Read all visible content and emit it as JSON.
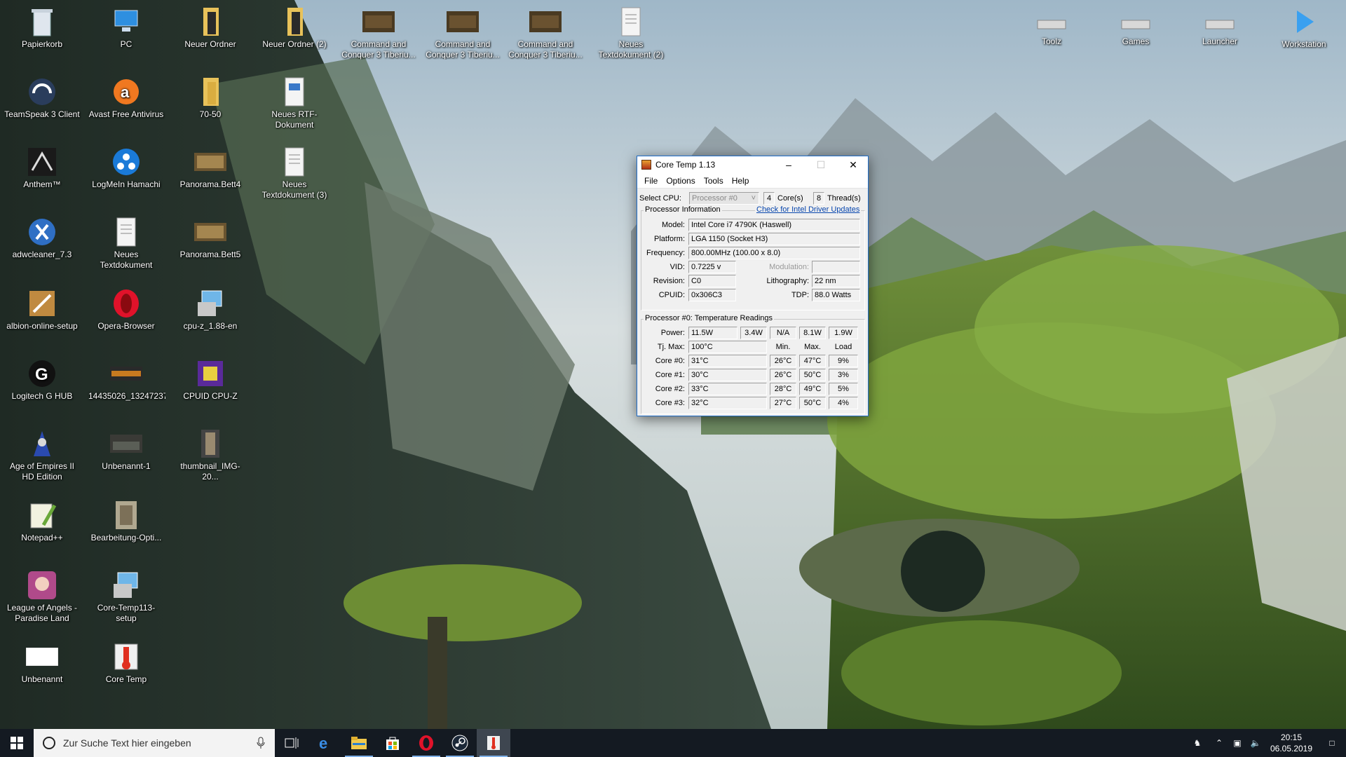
{
  "desktop": {
    "icons_left": [
      {
        "label": "Papierkorb",
        "icon": "recycle-bin-icon"
      },
      {
        "label": "PC",
        "icon": "computer-icon"
      },
      {
        "label": "Neuer Ordner",
        "icon": "folder-icon"
      },
      {
        "label": "Neuer Ordner (2)",
        "icon": "folder-icon"
      },
      {
        "label": "Command and Conquer 3  Tiberiu...",
        "icon": "game-shortcut-icon"
      },
      {
        "label": "Command and Conquer 3  Tiberiu...",
        "icon": "game-shortcut-icon"
      },
      {
        "label": "Command and Conquer 3  Tiberiu...",
        "icon": "game-shortcut-icon"
      },
      {
        "label": "Neues Textdokument (2)",
        "icon": "text-document-icon"
      },
      {
        "label": "TeamSpeak 3 Client",
        "icon": "headset-icon"
      },
      {
        "label": "Avast Free Antivirus",
        "icon": "avast-icon"
      },
      {
        "label": "70-50",
        "icon": "folder-icon"
      },
      {
        "label": "Neues RTF-Dokument",
        "icon": "rtf-document-icon"
      },
      {
        "label": "Anthem™",
        "icon": "anthem-icon"
      },
      {
        "label": "LogMeIn Hamachi",
        "icon": "hamachi-icon"
      },
      {
        "label": "Panorama.Bett4",
        "icon": "image-file-icon"
      },
      {
        "label": "Neues Textdokument (3)",
        "icon": "text-document-icon"
      },
      {
        "label": "adwcleaner_7.3",
        "icon": "adwcleaner-icon"
      },
      {
        "label": "Neues Textdokument",
        "icon": "text-document-icon"
      },
      {
        "label": "Panorama.Bett5",
        "icon": "image-file-icon"
      },
      {
        "label": "albion-online-setup",
        "icon": "setup-icon"
      },
      {
        "label": "Opera-Browser",
        "icon": "opera-icon"
      },
      {
        "label": "cpu-z_1.88-en",
        "icon": "installer-icon"
      },
      {
        "label": "Logitech G HUB",
        "icon": "logitech-icon"
      },
      {
        "label": "14435026_13247237...",
        "icon": "image-file-icon"
      },
      {
        "label": "CPUID CPU-Z",
        "icon": "cpuz-icon"
      },
      {
        "label": "Age of Empires II HD Edition",
        "icon": "aoe-icon"
      },
      {
        "label": "Unbenannt-1",
        "icon": "image-file-icon"
      },
      {
        "label": "thumbnail_IMG-20...",
        "icon": "image-file-icon"
      },
      {
        "label": "Notepad++",
        "icon": "notepadpp-icon"
      },
      {
        "label": "Bearbeitung-Opti...",
        "icon": "image-file-icon"
      },
      {
        "label": "League of Angels - Paradise Land",
        "icon": "game-icon"
      },
      {
        "label": "Core-Temp113-setup",
        "icon": "installer-icon"
      },
      {
        "label": "Unbenannt",
        "icon": "blank-file-icon"
      },
      {
        "label": "Core Temp",
        "icon": "core-temp-icon"
      }
    ],
    "icons_right": [
      {
        "label": "Toolz",
        "icon": "drive-icon"
      },
      {
        "label": "Games",
        "icon": "drive-icon"
      },
      {
        "label": "Launcher",
        "icon": "drive-icon"
      },
      {
        "label": "Workstation",
        "icon": "play-arrow-icon"
      }
    ]
  },
  "coretemp": {
    "title": "Core Temp 1.13",
    "menu": [
      "File",
      "Options",
      "Tools",
      "Help"
    ],
    "select_cpu_label": "Select CPU:",
    "processor_select": "Processor #0",
    "cores_value": "4",
    "cores_label": "Core(s)",
    "threads_value": "8",
    "threads_label": "Thread(s)",
    "proc_info_title": "Processor Information",
    "driver_link": "Check for Intel Driver Updates",
    "model_label": "Model:",
    "model": "Intel Core i7 4790K (Haswell)",
    "platform_label": "Platform:",
    "platform": "LGA 1150 (Socket H3)",
    "frequency_label": "Frequency:",
    "frequency": "800.00MHz (100.00 x 8.0)",
    "vid_label": "VID:",
    "vid": "0.7225 v",
    "modulation_label": "Modulation:",
    "modulation": "",
    "revision_label": "Revision:",
    "revision": "C0",
    "lithography_label": "Lithography:",
    "lithography": "22 nm",
    "cpuid_label": "CPUID:",
    "cpuid": "0x306C3",
    "tdp_label": "TDP:",
    "tdp": "88.0 Watts",
    "temp_title": "Processor #0: Temperature Readings",
    "power_label": "Power:",
    "power": [
      "11.5W",
      "3.4W",
      "N/A",
      "8.1W",
      "1.9W"
    ],
    "tjmax_label": "Tj. Max:",
    "tjmax": "100°C",
    "col_min": "Min.",
    "col_max": "Max.",
    "col_load": "Load",
    "cores": [
      {
        "label": "Core #0:",
        "temp": "31°C",
        "min": "26°C",
        "max": "47°C",
        "load": "9%"
      },
      {
        "label": "Core #1:",
        "temp": "30°C",
        "min": "26°C",
        "max": "50°C",
        "load": "3%"
      },
      {
        "label": "Core #2:",
        "temp": "33°C",
        "min": "28°C",
        "max": "49°C",
        "load": "5%"
      },
      {
        "label": "Core #3:",
        "temp": "32°C",
        "min": "27°C",
        "max": "50°C",
        "load": "4%"
      }
    ]
  },
  "taskbar": {
    "search_placeholder": "Zur Suche Text hier eingeben",
    "apps": [
      "task-view",
      "edge",
      "file-explorer",
      "store",
      "opera",
      "steam",
      "core-temp"
    ],
    "time": "20:15",
    "date": "06.05.2019"
  }
}
